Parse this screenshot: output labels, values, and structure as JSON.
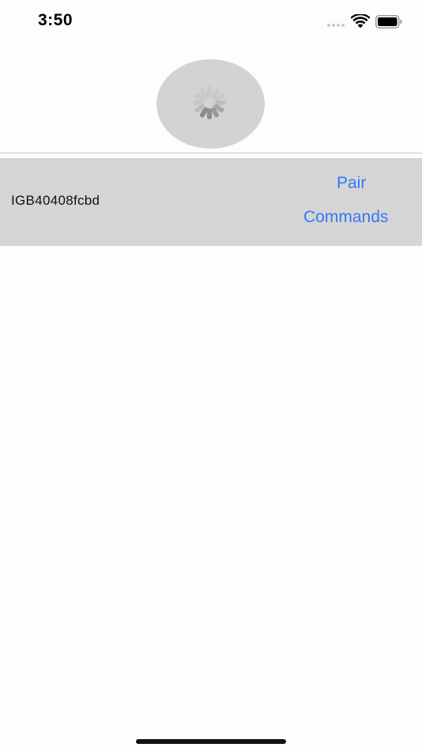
{
  "status_bar": {
    "time": "3:50",
    "signal_icon": "cellular-signal-icon",
    "wifi_icon": "wifi-icon",
    "battery_icon": "battery-icon"
  },
  "loader": {
    "icon": "activity-spinner-icon",
    "circle_color": "#d3d3d3"
  },
  "device": {
    "name": "IGB40408fcbd",
    "pair_label": "Pair",
    "commands_label": "Commands",
    "row_color": "#d5d5d5",
    "accent_color": "#3478f6"
  }
}
